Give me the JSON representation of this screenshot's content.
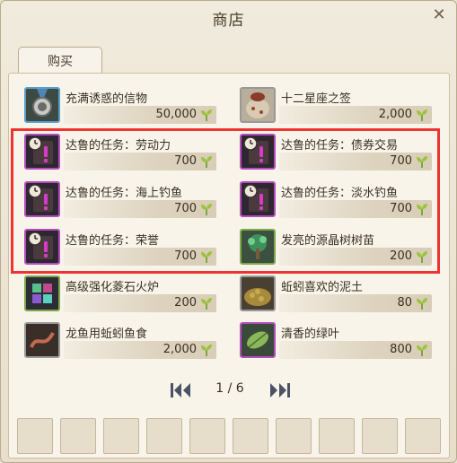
{
  "window": {
    "title": "商店"
  },
  "tabs": [
    {
      "label": "购买"
    }
  ],
  "items": [
    {
      "name": "充满诱惑的信物",
      "price": "50,000",
      "icon": "medal-icon",
      "border": "#5aa0c8"
    },
    {
      "name": "十二星座之签",
      "price": "2,000",
      "icon": "fortune-bag-icon",
      "border": "#999999"
    },
    {
      "name": "达鲁的任务：劳动力",
      "price": "700",
      "icon": "quest-scroll-icon",
      "border": "#b44dbd"
    },
    {
      "name": "达鲁的任务：债券交易",
      "price": "700",
      "icon": "quest-scroll-icon",
      "border": "#b44dbd"
    },
    {
      "name": "达鲁的任务：海上钓鱼",
      "price": "700",
      "icon": "quest-scroll-icon",
      "border": "#b44dbd"
    },
    {
      "name": "达鲁的任务：淡水钓鱼",
      "price": "700",
      "icon": "quest-scroll-icon",
      "border": "#b44dbd"
    },
    {
      "name": "达鲁的任务：荣誉",
      "price": "700",
      "icon": "quest-scroll-icon",
      "border": "#b44dbd"
    },
    {
      "name": "发亮的源晶树树苗",
      "price": "200",
      "icon": "sapling-icon",
      "border": "#7fa84b"
    },
    {
      "name": "高级强化菱石火炉",
      "price": "200",
      "icon": "gem-cube-icon",
      "border": "#7fa84b"
    },
    {
      "name": "蚯蚓喜欢的泥土",
      "price": "80",
      "icon": "soil-icon",
      "border": "#999999"
    },
    {
      "name": "龙鱼用蚯蚓鱼食",
      "price": "2,000",
      "icon": "worm-bait-icon",
      "border": "#999999"
    },
    {
      "name": "清香的绿叶",
      "price": "800",
      "icon": "leaf-icon",
      "border": "#b44dbd"
    }
  ],
  "currency_icon": "sprout-currency-icon",
  "pagination": {
    "text": "1 / 6"
  },
  "highlight_color": "#ee3333"
}
